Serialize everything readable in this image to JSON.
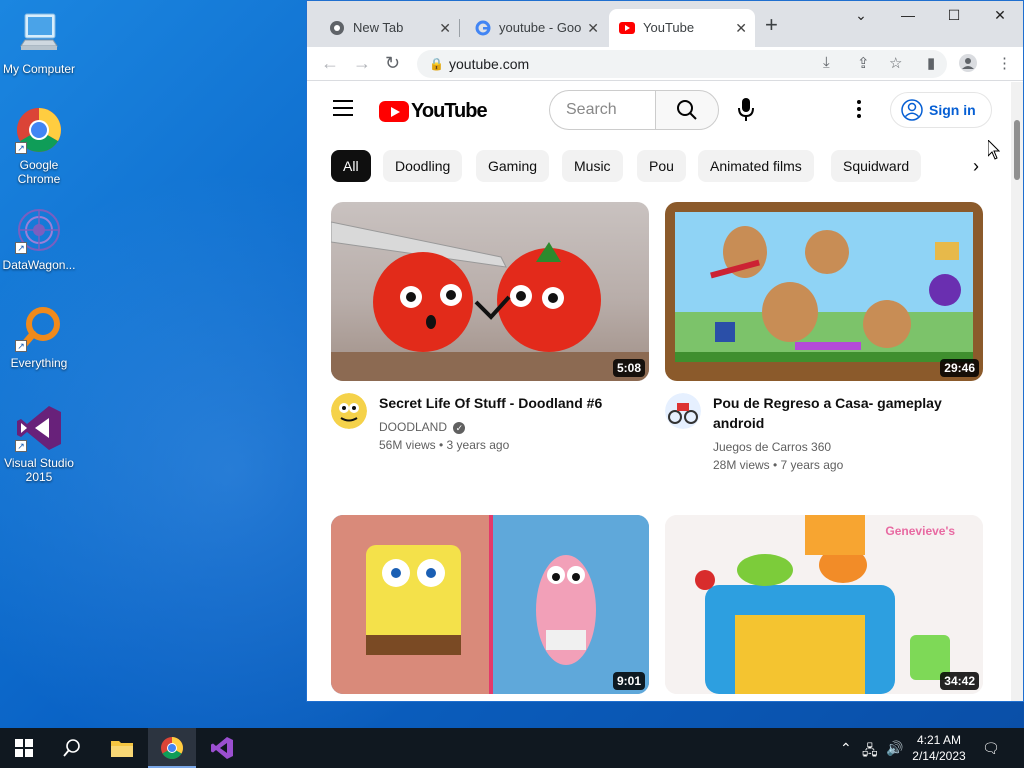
{
  "desktop": {
    "icons": [
      {
        "label": "My Computer",
        "icon": "computer-icon"
      },
      {
        "label": "Google Chrome",
        "icon": "chrome-icon"
      },
      {
        "label": "DataWagon...",
        "icon": "datawagon-icon"
      },
      {
        "label": "Everything",
        "icon": "everything-icon"
      },
      {
        "label": "Visual Studio 2015",
        "icon": "visual-studio-icon"
      }
    ]
  },
  "browser": {
    "tabs": [
      {
        "label": "New Tab",
        "favicon": "chrome-favicon"
      },
      {
        "label": "youtube - Goo",
        "favicon": "google-favicon"
      },
      {
        "label": "YouTube",
        "favicon": "youtube-favicon",
        "active": true
      }
    ],
    "url": "youtube.com"
  },
  "youtube": {
    "logo_text": "YouTube",
    "search_placeholder": "Search",
    "sign_in": "Sign in",
    "chips": [
      "All",
      "Doodling",
      "Gaming",
      "Music",
      "Pou",
      "Animated films",
      "Squidward"
    ],
    "videos": [
      {
        "title": "Secret Life Of Stuff - Doodland #6",
        "channel": "DOODLAND",
        "verified": true,
        "stats": "56M views • 3 years ago",
        "duration": "5:08"
      },
      {
        "title": "Pou de Regreso a Casa- gameplay android",
        "channel": "Juegos de Carros 360",
        "verified": false,
        "stats": "28M views • 7 years ago",
        "duration": "29:46"
      },
      {
        "title": "",
        "channel": "",
        "stats": "",
        "duration": "9:01"
      },
      {
        "title": "",
        "channel": "",
        "stats": "",
        "duration": "34:42"
      }
    ]
  },
  "taskbar": {
    "time": "4:21 AM",
    "date": "2/14/2023"
  },
  "colors": {
    "youtube_red": "#ff0000",
    "sign_in_blue": "#065fd4",
    "desktop_blue": "#0a63c6"
  }
}
